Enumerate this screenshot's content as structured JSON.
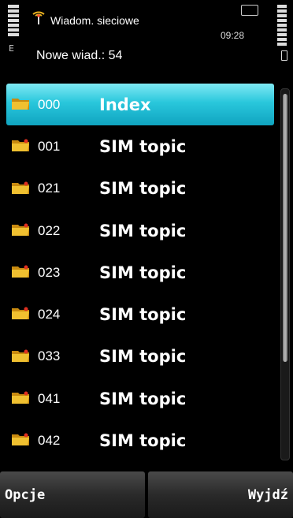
{
  "status_bar": {
    "title": "Wiadom. sieciowe",
    "subtitle": "Nowe wiad.: 54",
    "time": "09:28",
    "signal_indicator": "E",
    "icons": [
      "signal-strength-icon",
      "broadcast-antenna-icon",
      "message-envelope-icon",
      "battery-icon"
    ]
  },
  "list": {
    "items": [
      {
        "number": "000",
        "label": "Index",
        "selected": true
      },
      {
        "number": "001",
        "label": "SIM topic",
        "selected": false
      },
      {
        "number": "021",
        "label": "SIM topic",
        "selected": false
      },
      {
        "number": "022",
        "label": "SIM topic",
        "selected": false
      },
      {
        "number": "023",
        "label": "SIM topic",
        "selected": false
      },
      {
        "number": "024",
        "label": "SIM topic",
        "selected": false
      },
      {
        "number": "033",
        "label": "SIM topic",
        "selected": false
      },
      {
        "number": "041",
        "label": "SIM topic",
        "selected": false
      },
      {
        "number": "042",
        "label": "SIM topic",
        "selected": false
      }
    ]
  },
  "softkeys": {
    "left": "Opcje",
    "right": "Wyjdź"
  },
  "colors": {
    "selection": "#29c7dc",
    "folder": "#e8b020",
    "background": "#000000"
  }
}
